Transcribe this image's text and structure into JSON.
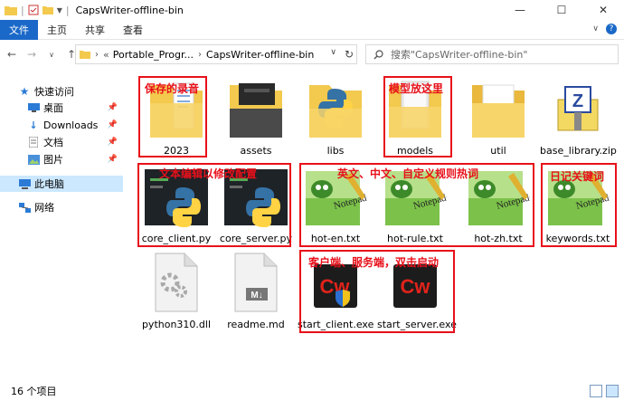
{
  "window": {
    "title": "CapsWriter-offline-bin",
    "minimize": "—",
    "maximize": "☐",
    "close": "✕"
  },
  "ribbon": {
    "tabs": [
      "文件",
      "主页",
      "共享",
      "查看"
    ]
  },
  "address": {
    "overflow": "«",
    "crumbs": [
      "Portable_Progr...",
      "CapsWriter-offline-bin"
    ],
    "search_placeholder": "搜索\"CapsWriter-offline-bin\""
  },
  "nav": {
    "items": [
      {
        "label": "快速访问",
        "icon": "star-icon"
      },
      {
        "label": "桌面",
        "icon": "desktop-icon",
        "pinned": true
      },
      {
        "label": "Downloads",
        "icon": "download-icon",
        "pinned": true
      },
      {
        "label": "文档",
        "icon": "document-icon",
        "pinned": true
      },
      {
        "label": "图片",
        "icon": "picture-icon",
        "pinned": true
      },
      {
        "label": "此电脑",
        "icon": "computer-icon"
      },
      {
        "label": "网络",
        "icon": "network-icon"
      }
    ]
  },
  "files": [
    {
      "name": "2023",
      "type": "folder-doc"
    },
    {
      "name": "assets",
      "type": "folder-dark"
    },
    {
      "name": "libs",
      "type": "folder-py"
    },
    {
      "name": "models",
      "type": "folder-doc"
    },
    {
      "name": "util",
      "type": "folder-open"
    },
    {
      "name": "base_library.zip",
      "type": "zip"
    },
    {
      "name": "core_client.py",
      "type": "py"
    },
    {
      "name": "core_server.py",
      "type": "py"
    },
    {
      "name": "hot-en.txt",
      "type": "npp"
    },
    {
      "name": "hot-rule.txt",
      "type": "npp"
    },
    {
      "name": "hot-zh.txt",
      "type": "npp"
    },
    {
      "name": "keywords.txt",
      "type": "npp"
    },
    {
      "name": "python310.dll",
      "type": "dll"
    },
    {
      "name": "readme.md",
      "type": "md"
    },
    {
      "name": "start_client.exe",
      "type": "cw-shield"
    },
    {
      "name": "start_server.exe",
      "type": "cw"
    }
  ],
  "annotations": {
    "saved_recordings": "保存的录音",
    "models_here": "模型放这里",
    "text_edit_config": "文本编辑以修改配置",
    "hotwords": "英文、中文、自定义规则热词",
    "diary_keywords": "日记关键词",
    "client_server_launch": "客户端、服务端，双击启动"
  },
  "status": {
    "count": "16 个项目"
  },
  "colors": {
    "accent": "#1a68c8",
    "annotation": "#e8101a",
    "selection": "#cce8ff"
  }
}
